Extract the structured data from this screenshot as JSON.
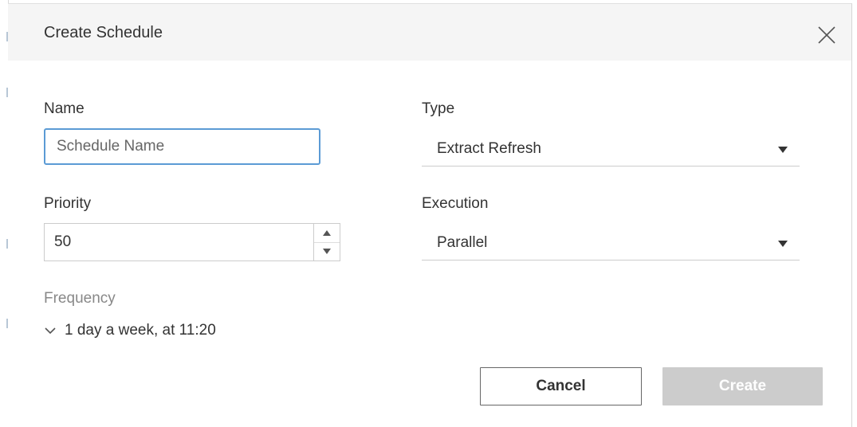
{
  "dialog": {
    "title": "Create Schedule",
    "close_icon": "close-icon"
  },
  "form": {
    "name": {
      "label": "Name",
      "placeholder": "Schedule Name",
      "value": ""
    },
    "type": {
      "label": "Type",
      "selected": "Extract Refresh",
      "icon": "caret-down-icon"
    },
    "priority": {
      "label": "Priority",
      "value": "50",
      "up_icon": "arrow-up-icon",
      "down_icon": "arrow-down-icon"
    },
    "execution": {
      "label": "Execution",
      "selected": "Parallel",
      "icon": "caret-down-icon"
    },
    "frequency": {
      "label": "Frequency",
      "summary": "1 day a week, at 11:20",
      "icon": "chevron-down-icon"
    }
  },
  "actions": {
    "cancel_label": "Cancel",
    "create_label": "Create"
  },
  "colors": {
    "header_bg": "#f5f5f5",
    "focus_border": "#5b9bd5",
    "disabled_button": "#cccccc",
    "muted_label": "#888888"
  }
}
